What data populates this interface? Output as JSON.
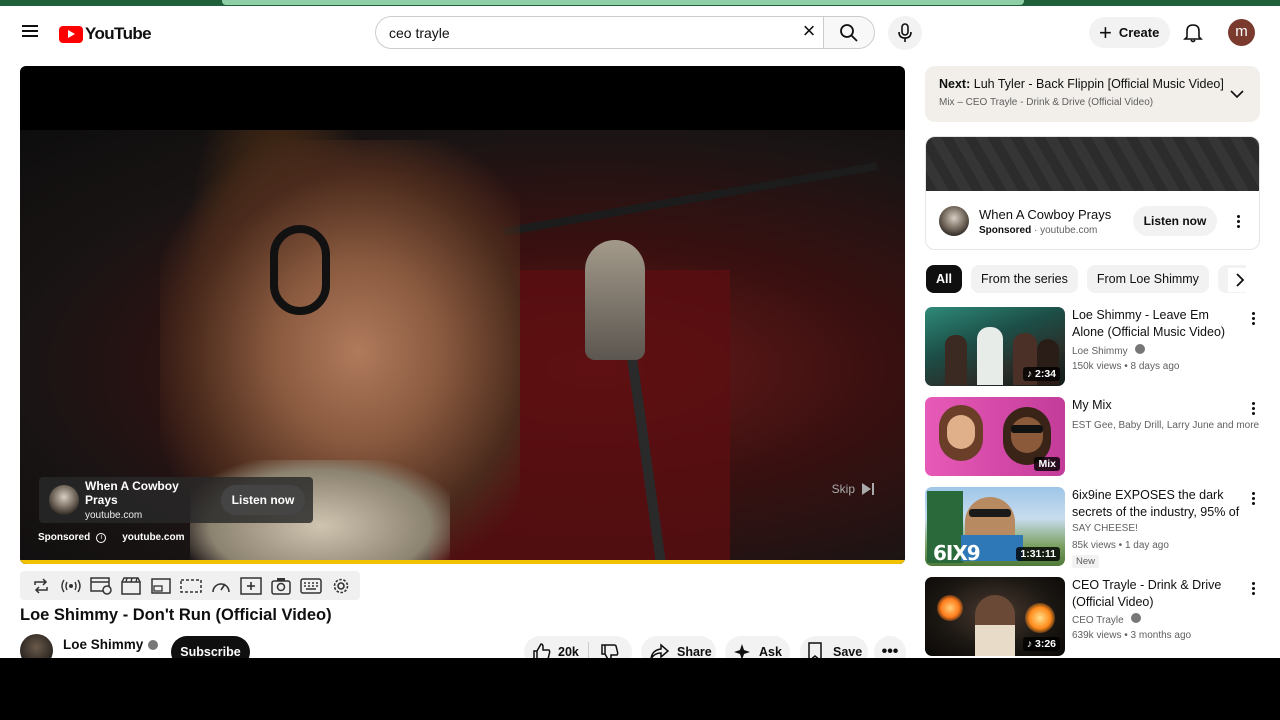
{
  "header": {
    "logo_text": "YouTube",
    "search_value": "ceo trayle",
    "create_label": "Create",
    "avatar_letter": "m"
  },
  "player": {
    "ad_title": "When A Cowboy Prays",
    "ad_url": "youtube.com",
    "ad_button": "Listen now",
    "skip_label": "Skip",
    "sponsored_label": "Sponsored",
    "sponsored_domain": "youtube.com",
    "progress_color": "#f2c200"
  },
  "toolbar": {
    "icons": [
      "loop-icon",
      "broadcast-icon",
      "playlist-video-icon",
      "clapper-icon",
      "picture-in-picture-icon",
      "theater-mode-icon",
      "speed-icon",
      "add-clip-icon",
      "screenshot-icon",
      "keyboard-icon",
      "settings-icon"
    ]
  },
  "video": {
    "title": "Loe Shimmy - Don't Run (Official Video)",
    "channel": "Loe Shimmy",
    "subscribe_label": "Subscribe",
    "likes": "20k",
    "share_label": "Share",
    "ask_label": "Ask",
    "save_label": "Save"
  },
  "sidebar": {
    "next_prefix": "Next:",
    "next_title": "Luh Tyler - Back Flippin [Official Music Video]",
    "next_sub": "Mix – CEO Trayle - Drink & Drive (Official Video)",
    "sponsor_title": "When A Cowboy Prays",
    "sponsor_label": "Sponsored",
    "sponsor_domain": "· youtube.com",
    "sponsor_button": "Listen now",
    "chips": [
      "All",
      "From the series",
      "From Loe Shimmy",
      "Lo"
    ],
    "recommendations": [
      {
        "title": "Loe Shimmy - Leave Em Alone (Official Music Video)",
        "channel": "Loe Shimmy",
        "meta": "150k views • 8 days ago",
        "duration": "♪ 2:34"
      },
      {
        "title": "My Mix",
        "channel": "EST Gee, Baby Drill, Larry June and more",
        "meta": "",
        "duration": "Mix"
      },
      {
        "title": "6ix9ine EXPOSES the dark secrets of the industry, 95% of ...",
        "channel": "SAY CHEESE!",
        "meta": "85k views • 1 day ago",
        "duration": "1:31:11",
        "badge": "New"
      },
      {
        "title": "CEO Trayle - Drink & Drive (Official Video)",
        "channel": "CEO Trayle",
        "meta": "639k views • 3 months ago",
        "duration": "♪ 3:26"
      }
    ]
  }
}
